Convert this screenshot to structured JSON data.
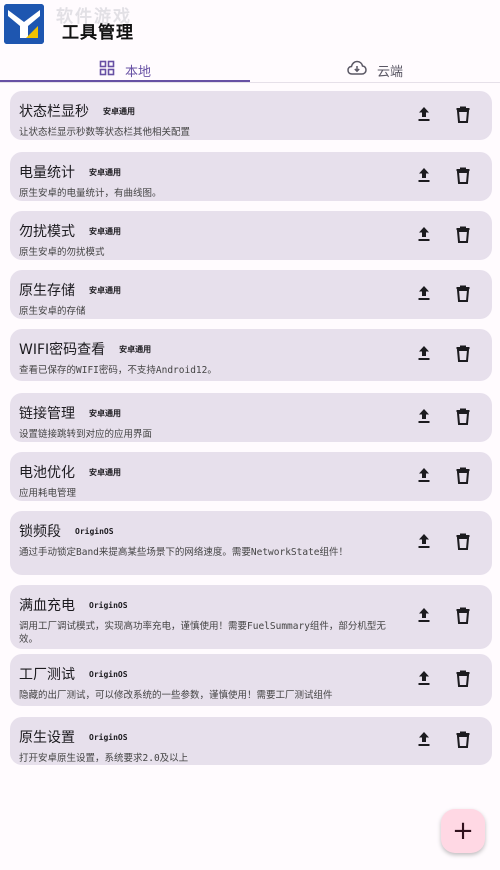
{
  "app": {
    "title": "工具管理",
    "watermark": "软件游戏"
  },
  "tabs": [
    {
      "label": "本地",
      "icon": "grid-icon",
      "selected": true
    },
    {
      "label": "云端",
      "icon": "cloud-download-icon",
      "selected": false
    }
  ],
  "tools": [
    {
      "title": "状态栏显秒",
      "tag": "安卓通用",
      "desc": "让状态栏显示秒数等状态栏其他相关配置"
    },
    {
      "title": "电量统计",
      "tag": "安卓通用",
      "desc": "原生安卓的电量统计，有曲线图。"
    },
    {
      "title": "勿扰模式",
      "tag": "安卓通用",
      "desc": "原生安卓的勿扰模式"
    },
    {
      "title": "原生存储",
      "tag": "安卓通用",
      "desc": "原生安卓的存储"
    },
    {
      "title": "WIFI密码查看",
      "tag": "安卓通用",
      "desc": "查看已保存的WIFI密码，不支持Android12。"
    },
    {
      "title": "链接管理",
      "tag": "安卓通用",
      "desc": "设置链接跳转到对应的应用界面"
    },
    {
      "title": "电池优化",
      "tag": "安卓通用",
      "desc": "应用耗电管理"
    },
    {
      "title": "锁频段",
      "tag": "OriginOS",
      "desc": "通过手动锁定Band来提高某些场景下的网络速度。需要NetworkState组件！"
    },
    {
      "title": "满血充电",
      "tag": "OriginOS",
      "desc": "调用工厂调试模式，实现高功率充电，谨慎使用！需要FuelSummary组件，部分机型无效。"
    },
    {
      "title": "工厂测试",
      "tag": "OriginOS",
      "desc": "隐藏的出厂测试，可以修改系统的一些参数，谨慎使用！需要工厂测试组件"
    },
    {
      "title": "原生设置",
      "tag": "OriginOS",
      "desc": "打开安卓原生设置，系统要求2.0及以上"
    }
  ],
  "fab": {
    "label": "+"
  },
  "colors": {
    "accent": "#6750a4",
    "card": "#e7e0ec",
    "fab": "#ffd8e4"
  }
}
